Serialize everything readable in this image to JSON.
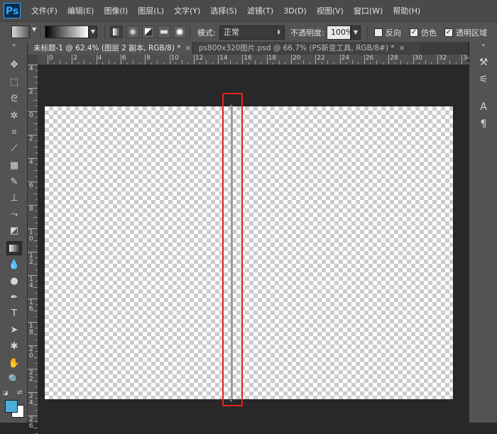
{
  "app": {
    "logo": "Ps"
  },
  "menu": [
    "文件(F)",
    "编辑(E)",
    "图像(I)",
    "图层(L)",
    "文字(Y)",
    "选择(S)",
    "滤镜(T)",
    "3D(D)",
    "视图(V)",
    "窗口(W)",
    "帮助(H)"
  ],
  "options": {
    "mode_label": "模式:",
    "mode_value": "正常",
    "opacity_label": "不透明度:",
    "opacity_value": "100%",
    "reverse_label": "反向",
    "dither_label": "仿色",
    "transparency_label": "透明区域",
    "checkmark": "✓"
  },
  "tabs": [
    {
      "label": "未标题-1 @ 62.4% (图层 2 副本, RGB/8) *",
      "close": "×"
    },
    {
      "label": "ps800x320图片.psd @ 66.7% (PS新变工具, RGB/8#) *",
      "close": "×"
    }
  ],
  "ruler": {
    "h_labels": [
      "0",
      "2",
      "4",
      "6",
      "8",
      "10",
      "12",
      "14",
      "16",
      "18",
      "20",
      "22",
      "24",
      "26",
      "28",
      "30",
      "32",
      "34"
    ],
    "v_labels": [
      "4",
      "2",
      "0",
      "2",
      "4",
      "6",
      "8",
      "1\n0",
      "1\n2",
      "1\n4",
      "1\n6",
      "1\n8",
      "2\n0",
      "2\n2",
      "2\n4",
      "2\n6"
    ]
  },
  "colors": {
    "accent": "#31a8ff",
    "highlight": "#e1261c",
    "foreground": "#4aaed8",
    "background": "#ffffff"
  }
}
